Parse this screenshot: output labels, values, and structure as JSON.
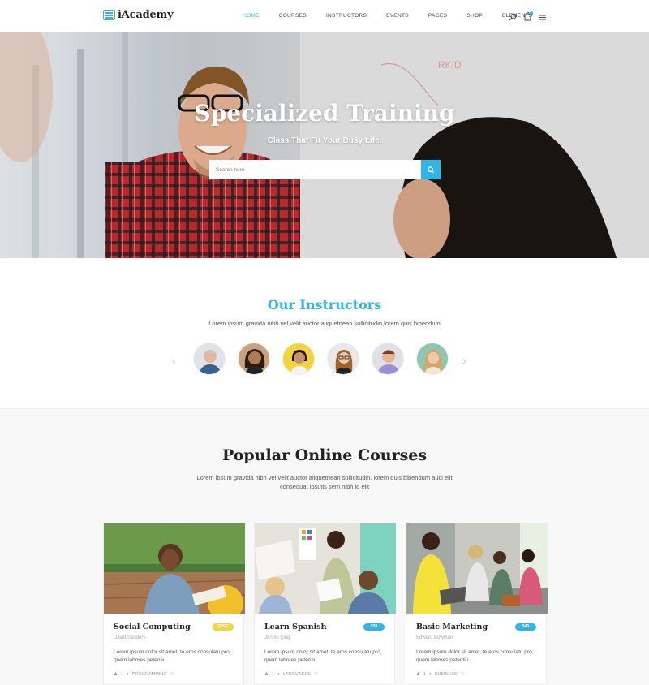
{
  "header": {
    "logo_text": "iAcademy",
    "nav": [
      {
        "label": "HOME",
        "active": true
      },
      {
        "label": "COURSES",
        "active": false
      },
      {
        "label": "INSTRUCTORS",
        "active": false
      },
      {
        "label": "EVENTS",
        "active": false
      },
      {
        "label": "PAGES",
        "active": false
      },
      {
        "label": "SHOP",
        "active": false
      },
      {
        "label": "ELEMENTS",
        "active": false
      }
    ],
    "icons": [
      "search-icon",
      "cart-icon",
      "menu-icon"
    ]
  },
  "hero": {
    "title": "Specialized Training",
    "subtitle": "Class That Fit Your Busy Life.",
    "search_placeholder": "Search here"
  },
  "instructors": {
    "title": "Our Instructors",
    "text": "Lorem ipsum gravida nibh vel velit auctor aliquetnean sollicitudin,lorem quis bibendum",
    "avatar_count": 6
  },
  "courses": {
    "title": "Popular Online Courses",
    "text": "Lorem ipsum gravida nibh vel velit auctor aliquetnean sollicitudin, lorem quis bibendum auci elit consequat ipsutis sem nibh id elit",
    "items": [
      {
        "title": "Social Computing",
        "badge": "FREE",
        "badge_color": "#f5d33a",
        "author": "David Sanders",
        "desc": "Lorem ipsum dolor sit amet, te eros consulatu pro, quem labores petentiu",
        "students": "1",
        "category": "PROGRAMMING"
      },
      {
        "title": "Learn Spanish",
        "badge": "$20",
        "badge_color": "#2fb5e8",
        "author": "Jennie King",
        "desc": "Lorem ipsum dolor sit amet, te eros consulatu pro, quem labores petentiu",
        "students": "1",
        "category": "LANGUAGES"
      },
      {
        "title": "Basic Marketing",
        "badge": "$40",
        "badge_color": "#2fb5e8",
        "author": "Edward Bowman",
        "desc": "Lorem ipsum dolor sit amet, te eros consulatu pro, quem labores petentiu",
        "students": "1",
        "category": "BUSINESS"
      }
    ]
  },
  "colors": {
    "accent": "#2fb5e8",
    "free_badge": "#f5d33a"
  }
}
